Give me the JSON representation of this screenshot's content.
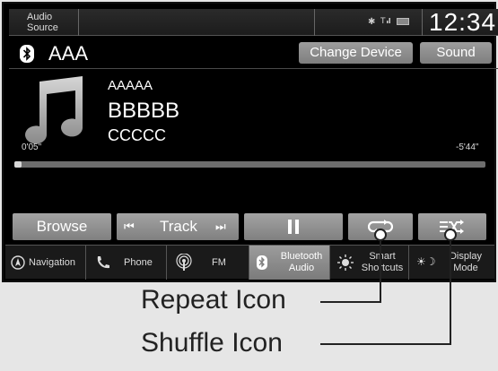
{
  "status_bar": {
    "audio_source": "Audio\nSource",
    "audio_source_l1": "Audio",
    "audio_source_l2": "Source",
    "time": "12:34"
  },
  "device": {
    "name": "AAA",
    "change_device_label": "Change Device",
    "sound_label": "Sound"
  },
  "track": {
    "line1": "AAAAA",
    "line2": "BBBBB",
    "line3": "CCCCC",
    "elapsed": "0'05\"",
    "remaining": "-5'44\"",
    "progress_fraction": 0.015
  },
  "controls": {
    "browse_label": "Browse",
    "track_label": "Track",
    "pause_symbol": "II"
  },
  "navbar": {
    "items": [
      {
        "label": "Navigation"
      },
      {
        "label": "Phone"
      },
      {
        "label": "FM"
      },
      {
        "label_l1": "Bluetooth",
        "label_l2": "Audio"
      },
      {
        "label_l1": "Smart",
        "label_l2": "Shortcuts"
      },
      {
        "label_l1": "Display",
        "label_l2": "Mode"
      }
    ]
  },
  "callouts": {
    "repeat": "Repeat Icon",
    "shuffle": "Shuffle Icon"
  },
  "colors": {
    "screen_bg": "#000000",
    "button_gray": "#8f8f8f",
    "page_bg": "#e6e6e6"
  }
}
